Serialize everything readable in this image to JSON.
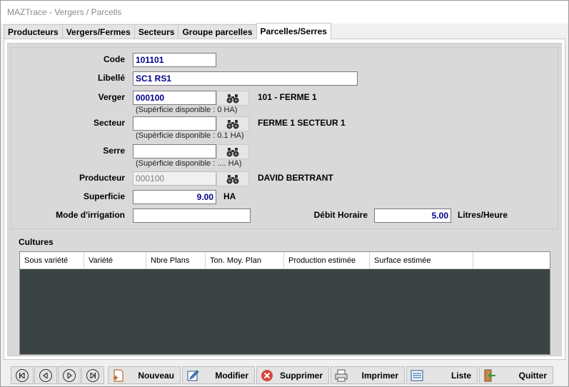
{
  "window": {
    "title": "MAZTrace - Vergers / Parcells"
  },
  "tabs": [
    {
      "label": "Producteurs",
      "active": false
    },
    {
      "label": "Vergers/Fermes",
      "active": false
    },
    {
      "label": "Secteurs",
      "active": false
    },
    {
      "label": "Groupe parcelles",
      "active": false
    },
    {
      "label": "Parcelles/Serres",
      "active": true
    }
  ],
  "form": {
    "code": {
      "label": "Code",
      "value": "101101"
    },
    "libelle": {
      "label": "Libellé",
      "value": "SC1 RS1"
    },
    "verger": {
      "label": "Verger",
      "value": "000100",
      "info": "101 - FERME 1",
      "hint": "(Supérficie disponible : 0 HA)"
    },
    "secteur": {
      "label": "Secteur",
      "value": "",
      "info": "FERME 1 SECTEUR 1",
      "hint": "(Supérficie disponible : 0.1 HA)"
    },
    "serre": {
      "label": "Serre",
      "value": "",
      "hint": "(Supérficie disponible : .... HA)"
    },
    "producteur": {
      "label": "Producteur",
      "value": "000100",
      "info": "DAVID BERTRANT"
    },
    "superficie": {
      "label": "Superficie",
      "value": "9.00",
      "unit": "HA"
    },
    "irrigation": {
      "label": "Mode d'irrigation",
      "value": ""
    },
    "debit": {
      "label": "Débit Horaire",
      "value": "5.00",
      "unit": "Litres/Heure"
    }
  },
  "cultures": {
    "title": "Cultures",
    "columns": [
      "Sous variété",
      "Variété",
      "Nbre Plans",
      "Ton. Moy. Plan",
      "Production estimée",
      "Surface estimée"
    ]
  },
  "toolbar": {
    "nouveau": "Nouveau",
    "modifier": "Modifier",
    "supprimer": "Supprimer",
    "imprimer": "Imprimer",
    "liste": "Liste",
    "quitter": "Quitter"
  },
  "colors": {
    "field_text": "#00008b",
    "grid_bg": "#3c4344",
    "panel_bg": "#d9d9d9"
  }
}
